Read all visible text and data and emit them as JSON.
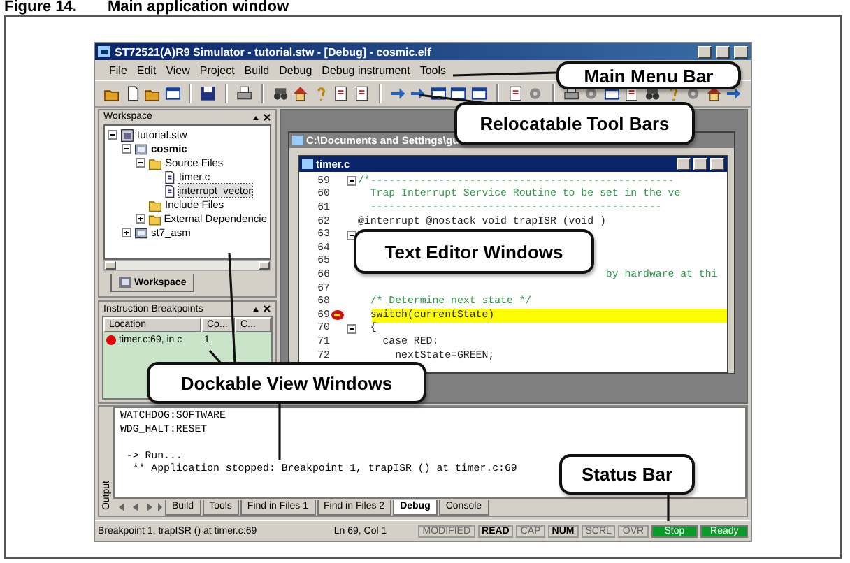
{
  "figure": {
    "number": "Figure 14.",
    "title": "Main application window"
  },
  "window": {
    "title": "ST72521(A)R9 Simulator - tutorial.stw - [Debug] - cosmic.elf"
  },
  "menu": [
    "File",
    "Edit",
    "View",
    "Project",
    "Build",
    "Debug",
    "Debug instrument",
    "Tools"
  ],
  "workspace": {
    "title": "Workspace",
    "tab": "Workspace",
    "tree": [
      {
        "label": "tutorial.stw",
        "kind": "workspace",
        "selected": false,
        "expanded": true,
        "children": [
          {
            "label": "cosmic",
            "kind": "project",
            "selected": false,
            "active": true,
            "expanded": true,
            "children": [
              {
                "label": "Source Files",
                "kind": "folder",
                "selected": false,
                "expanded": true,
                "children": [
                  {
                    "label": "timer.c",
                    "kind": "file",
                    "selected": false
                  },
                  {
                    "label": "interrupt_vector",
                    "kind": "file",
                    "selected": true
                  }
                ]
              },
              {
                "label": "Include Files",
                "kind": "folder",
                "selected": false
              },
              {
                "label": "External Dependencie",
                "kind": "folder",
                "selected": false,
                "expanded": false
              }
            ]
          },
          {
            "label": "st7_asm",
            "kind": "project",
            "selected": false,
            "active": false,
            "expanded": false
          }
        ]
      }
    ]
  },
  "breakpoints": {
    "title": "Instruction Breakpoints",
    "columns": [
      "Location",
      "Co...",
      "C..."
    ],
    "rows": [
      {
        "enabled": true,
        "cells": [
          "timer.c:69, in c",
          "1",
          ""
        ]
      }
    ]
  },
  "back_window": {
    "title": "C:\\Documents and Settings\\gu"
  },
  "editor": {
    "title": "timer.c",
    "lines": [
      {
        "number": "59",
        "kind": "comment",
        "fold": true,
        "breakpoint": false,
        "highlight": false,
        "text": "/*-------------------------------------------------"
      },
      {
        "number": "60",
        "kind": "comment",
        "fold": false,
        "breakpoint": false,
        "highlight": false,
        "text": "  Trap Interrupt Service Routine to be set in the ve"
      },
      {
        "number": "61",
        "kind": "comment",
        "fold": false,
        "breakpoint": false,
        "highlight": false,
        "text": "  -----------------------------------------------"
      },
      {
        "number": "62",
        "kind": "code",
        "fold": false,
        "breakpoint": false,
        "highlight": false,
        "text": "@interrupt @nostack void trapISR (void )"
      },
      {
        "number": "63",
        "kind": "code",
        "fold": true,
        "breakpoint": false,
        "highlight": false
      },
      {
        "number": "64",
        "kind": "code",
        "fold": false,
        "breakpoint": false,
        "highlight": false
      },
      {
        "number": "65",
        "kind": "code",
        "fold": false,
        "breakpoint": false,
        "highlight": false
      },
      {
        "number": "66",
        "kind": "comment",
        "fold": false,
        "breakpoint": false,
        "highlight": false,
        "text": "                                        by hardware at thi"
      },
      {
        "number": "67",
        "kind": "code",
        "fold": false,
        "breakpoint": false,
        "highlight": false
      },
      {
        "number": "68",
        "kind": "comment",
        "fold": false,
        "breakpoint": false,
        "highlight": false,
        "text": "  /* Determine next state */"
      },
      {
        "number": "69",
        "kind": "code",
        "fold": false,
        "breakpoint": true,
        "highlight": true,
        "text": "  switch(currentState)"
      },
      {
        "number": "70",
        "kind": "code",
        "fold": true,
        "breakpoint": false,
        "highlight": false,
        "text": "  {"
      },
      {
        "number": "71",
        "kind": "code",
        "fold": false,
        "breakpoint": false,
        "highlight": false,
        "text": "    case RED:"
      },
      {
        "number": "72",
        "kind": "code",
        "fold": false,
        "breakpoint": false,
        "highlight": false,
        "text": "      nextState=GREEN;"
      }
    ]
  },
  "output": {
    "label": "Output",
    "lines": [
      {
        "text": "WATCHDOG:SOFTWARE",
        "spaced": false
      },
      {
        "text": "WDG_HALT:RESET",
        "spaced": false
      },
      {
        "text": " -> Run...",
        "spaced": true
      },
      {
        "text": "  ** Application stopped: Breakpoint 1, trapISR () at timer.c:69",
        "spaced": false
      }
    ],
    "tabs": [
      {
        "label": "Build",
        "selected": false
      },
      {
        "label": "Tools",
        "selected": false
      },
      {
        "label": "Find in Files 1",
        "selected": false
      },
      {
        "label": "Find in Files 2",
        "selected": false
      },
      {
        "label": "Debug",
        "selected": true
      },
      {
        "label": "Console",
        "selected": false
      }
    ]
  },
  "status_bar": {
    "message": "Breakpoint 1, trapISR () at timer.c:69",
    "position": "Ln 69, Col 1",
    "indicators": [
      {
        "label": "MODIFIED",
        "on": false
      },
      {
        "label": "READ",
        "on": true
      },
      {
        "label": "CAP",
        "on": false
      },
      {
        "label": "NUM",
        "on": true
      },
      {
        "label": "SCRL",
        "on": false
      },
      {
        "label": "OVR",
        "on": false
      }
    ],
    "states": [
      "Stop",
      "Ready"
    ]
  },
  "callouts": [
    "Main Menu Bar",
    "Relocatable Tool Bars",
    "Text Editor Windows",
    "Dockable View Windows",
    "Status Bar"
  ]
}
